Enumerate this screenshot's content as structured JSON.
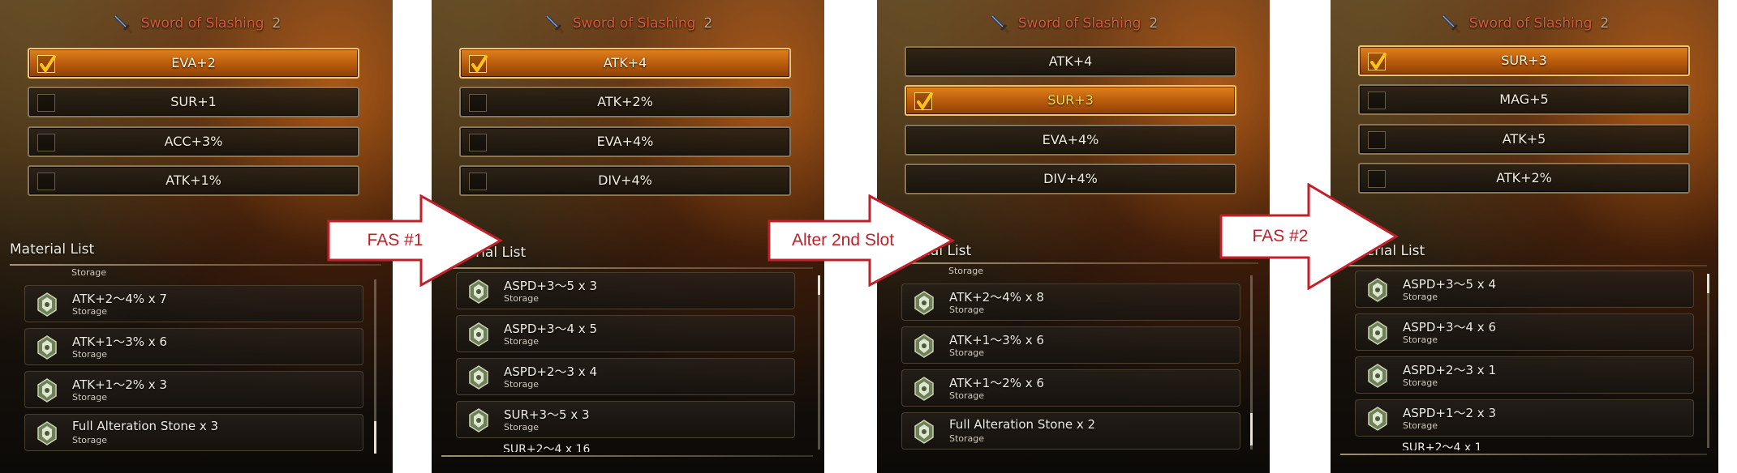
{
  "steps": [
    {
      "title": "Sword of Slashing",
      "title_count": "2",
      "slots": [
        {
          "label": "EVA+2",
          "selected": true
        },
        {
          "label": "SUR+1",
          "selected": false
        },
        {
          "label": "ACC+3%",
          "selected": false
        },
        {
          "label": "ATK+1%",
          "selected": false
        }
      ],
      "material_header": "Material List",
      "top_partial_sub": "Storage",
      "materials": [
        {
          "name": "ATK+2～4% x 7",
          "sub": "Storage"
        },
        {
          "name": "ATK+1～3% x 6",
          "sub": "Storage"
        },
        {
          "name": "ATK+1～2% x 3",
          "sub": "Storage"
        },
        {
          "name": "Full Alteration Stone x 3",
          "sub": "Storage"
        }
      ]
    },
    {
      "title": "Sword of Slashing",
      "title_count": "2",
      "slots": [
        {
          "label": "ATK+4",
          "selected": true
        },
        {
          "label": "ATK+2%",
          "selected": false
        },
        {
          "label": "EVA+4%",
          "selected": false
        },
        {
          "label": "DIV+4%",
          "selected": false
        }
      ],
      "material_header": "Material List",
      "materials": [
        {
          "name": "ASPD+3～5 x 3",
          "sub": "Storage"
        },
        {
          "name": "ASPD+3～4 x 5",
          "sub": "Storage"
        },
        {
          "name": "ASPD+2～3 x 4",
          "sub": "Storage"
        },
        {
          "name": "SUR+3～5 x 3",
          "sub": "Storage"
        }
      ],
      "bottom_partial": "SUR+2～4 x 16"
    },
    {
      "title": "Sword of Slashing",
      "title_count": "2",
      "slots": [
        {
          "label": "ATK+4",
          "selected": false
        },
        {
          "label": "SUR+3",
          "selected": true
        },
        {
          "label": "EVA+4%",
          "selected": false
        },
        {
          "label": "DIV+4%",
          "selected": false
        }
      ],
      "material_header": "Material List",
      "top_partial_sub": "Storage",
      "materials": [
        {
          "name": "ATK+2～4% x 8",
          "sub": "Storage"
        },
        {
          "name": "ATK+1～3% x 6",
          "sub": "Storage"
        },
        {
          "name": "ATK+1～2% x 6",
          "sub": "Storage"
        },
        {
          "name": "Full Alteration Stone x 2",
          "sub": "Storage"
        }
      ]
    },
    {
      "title": "Sword of Slashing",
      "title_count": "2",
      "slots": [
        {
          "label": "SUR+3",
          "selected": true
        },
        {
          "label": "MAG+5",
          "selected": false
        },
        {
          "label": "ATK+5",
          "selected": false
        },
        {
          "label": "ATK+2%",
          "selected": false
        }
      ],
      "material_header": "Material List",
      "materials": [
        {
          "name": "ASPD+3～5 x 4",
          "sub": "Storage"
        },
        {
          "name": "ASPD+3～4 x 6",
          "sub": "Storage"
        },
        {
          "name": "ASPD+2～3 x 1",
          "sub": "Storage"
        },
        {
          "name": "ASPD+1～2 x 3",
          "sub": "Storage"
        }
      ],
      "bottom_partial": "SUR+2～4 x 1"
    }
  ],
  "arrows": [
    {
      "label": "FAS #1"
    },
    {
      "label": "Alter 2nd Slot"
    },
    {
      "label": "FAS #2"
    }
  ],
  "colors": {
    "title": "#d25a3a",
    "slot_selected": "#c8680e",
    "arrow_stroke": "#c0202a"
  },
  "icons": {
    "weapon": "sword-icon",
    "check": "checkmark-icon",
    "material": "alteration-stone-icon"
  }
}
